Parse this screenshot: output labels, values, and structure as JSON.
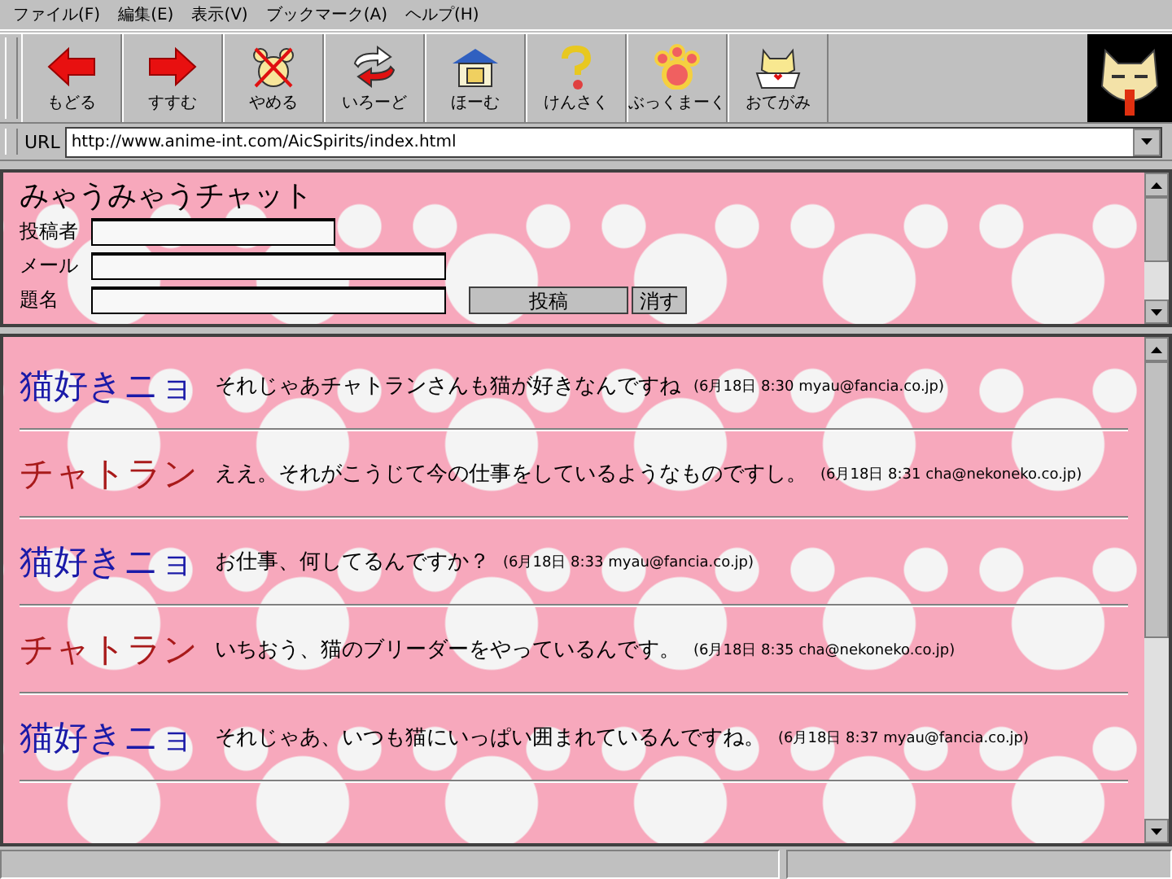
{
  "menu": [
    "ファイル(F)",
    "編集(E)",
    "表示(V)",
    "ブックマーク(A)",
    "ヘルプ(H)"
  ],
  "toolbar": [
    {
      "label": "もどる",
      "kind": "back"
    },
    {
      "label": "すすむ",
      "kind": "forward"
    },
    {
      "label": "やめる",
      "kind": "stop"
    },
    {
      "label": "いろーど",
      "kind": "reload"
    },
    {
      "label": "ほーむ",
      "kind": "home"
    },
    {
      "label": "けんさく",
      "kind": "search"
    },
    {
      "label": "ぶっくまーく",
      "kind": "bookmark"
    },
    {
      "label": "おてがみ",
      "kind": "mail"
    }
  ],
  "url_bar": {
    "label": "URL",
    "value": "http://www.anime-int.com/AicSpirits/index.html"
  },
  "form": {
    "title": "みゃうみゃうチャット",
    "fields": [
      {
        "label": "投稿者"
      },
      {
        "label": "メール"
      },
      {
        "label": "題名"
      }
    ],
    "buttons": [
      "投稿",
      "消す"
    ]
  },
  "messages": [
    {
      "name": "猫好きニョ",
      "color": "#1a1aa8",
      "text": "それじゃあチャトランさんも猫が好きなんですね",
      "meta": "(6月18日 8:30 myau@fancia.co.jp)"
    },
    {
      "name": "チャトラン",
      "color": "#a81a1a",
      "text": "ええ。それがこうじて今の仕事をしているようなものですし。",
      "meta": "(6月18日 8:31 cha@nekoneko.co.jp)"
    },
    {
      "name": "猫好きニョ",
      "color": "#1a1aa8",
      "text": "お仕事、何してるんですか？",
      "meta": "(6月18日 8:33 myau@fancia.co.jp)"
    },
    {
      "name": "チャトラン",
      "color": "#a81a1a",
      "text": "いちおう、猫のブリーダーをやっているんです。",
      "meta": "(6月18日 8:35 cha@nekoneko.co.jp)"
    },
    {
      "name": "猫好きニョ",
      "color": "#1a1aa8",
      "text": "それじゃあ、いつも猫にいっぱい囲まれているんですね。",
      "meta": "(6月18日 8:37 myau@fancia.co.jp)"
    }
  ]
}
